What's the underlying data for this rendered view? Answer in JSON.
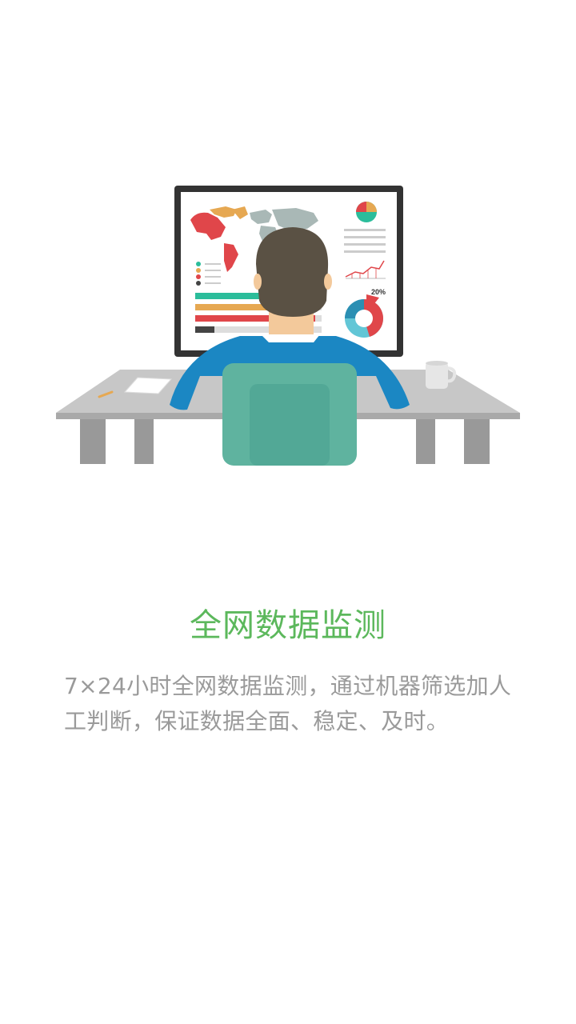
{
  "illustration": {
    "icon": "person-monitoring-dashboard-illustration",
    "chart_percent_label": "20%",
    "colors": {
      "frame": "#333333",
      "desk": "#a9a9a9",
      "shirt": "#1b87c3",
      "chair": "#5fb39f",
      "hair": "#5a5144",
      "skin": "#f3c99b",
      "teal": "#2bbd9b",
      "orange": "#e6a852",
      "red": "#e0464a",
      "gray_map": "#a9b8b6"
    }
  },
  "onboarding": {
    "title": "全网数据监测",
    "description": "7×24小时全网数据监测，通过机器筛选加人工判断，保证数据全面、稳定、及时。"
  }
}
